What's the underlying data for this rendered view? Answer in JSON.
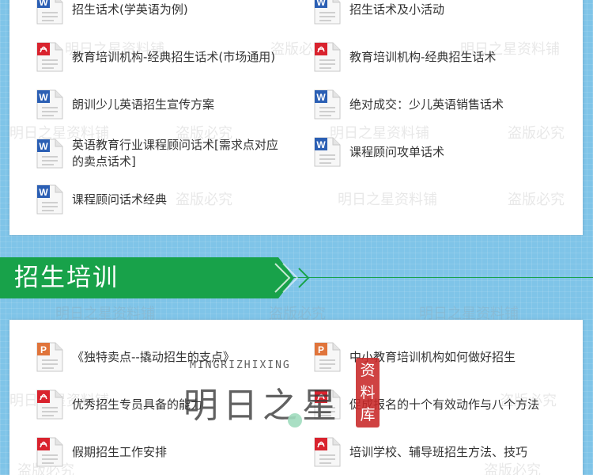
{
  "colors": {
    "background": "#7fc4e8",
    "banner_green": "#18a24a",
    "word_blue": "#2b5fb4",
    "pdf_red": "#d9232e",
    "ppt_orange": "#e0743b",
    "text": "#333333"
  },
  "top_section": {
    "items": [
      {
        "icon": "word-doc-icon",
        "label": "招生话术(学英语为例)"
      },
      {
        "icon": "word-doc-icon",
        "label": "招生话术及小活动"
      },
      {
        "icon": "pdf-doc-icon",
        "label": "教育培训机构-经典招生话术(市场通用)"
      },
      {
        "icon": "pdf-doc-icon",
        "label": "教育培训机构-经典招生话术"
      },
      {
        "icon": "word-doc-icon",
        "label": "朗训少儿英语招生宣传方案"
      },
      {
        "icon": "word-doc-icon",
        "label": "绝对成交：少儿英语销售话术"
      },
      {
        "icon": "word-doc-icon",
        "label": "英语教育行业课程顾问话术[需求点对应的卖点话术]"
      },
      {
        "icon": "word-doc-icon",
        "label": "课程顾问攻单话术"
      },
      {
        "icon": "word-doc-icon",
        "label": "课程顾问话术经典"
      }
    ]
  },
  "banner": {
    "title": "招生培训"
  },
  "bottom_section": {
    "items": [
      {
        "icon": "ppt-doc-icon",
        "label": "《独特卖点--撬动招生的支点》"
      },
      {
        "icon": "ppt-doc-icon",
        "label": "中小教育培训机构如何做好招生"
      },
      {
        "icon": "pdf-doc-icon",
        "label": "优秀招生专员具备的能力"
      },
      {
        "icon": "pdf-doc-icon",
        "label": "促成报名的十个有效动作与八个方法"
      },
      {
        "icon": "pdf-doc-icon",
        "label": "假期招生工作安排"
      },
      {
        "icon": "pdf-doc-icon",
        "label": "培训学校、辅导班招生方法、技巧"
      }
    ]
  },
  "watermark": {
    "text_a": "明日之星资料铺",
    "text_b": "盗版必究"
  },
  "logo": {
    "english": "MINGRIZHIXING",
    "chinese": "明日之星",
    "seal": [
      "资",
      "料",
      "库"
    ]
  }
}
